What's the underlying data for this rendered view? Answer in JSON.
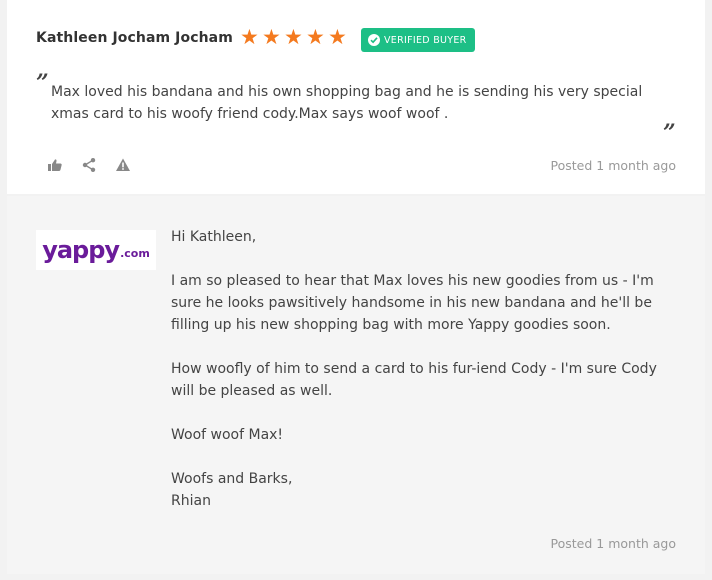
{
  "review": {
    "reviewer_name": "Kathleen Jocham Jocham",
    "rating": 5,
    "star_color": "#f47a1f",
    "verified_label": "VERIFIED BUYER",
    "verified_color": "#1dbf86",
    "open_quote": "”",
    "close_quote": "”",
    "text": "Max loved his bandana and his own shopping bag and he is sending his very special xmas card to his woofy friend cody.Max says woof woof .",
    "actions": [
      "thumbs-up-icon",
      "share-icon",
      "report-warning-icon"
    ],
    "posted": "Posted 1 month ago"
  },
  "reply": {
    "logo_text": "yappy",
    "logo_suffix": ".com",
    "logo_color": "#6a1b9a",
    "greeting": "Hi Kathleen,",
    "paragraph_1": "I am so pleased to hear that Max loves his new goodies from us - I'm sure he looks pawsitively handsome in his new bandana and he'll be filling up his new shopping bag with more Yappy goodies soon.",
    "paragraph_2": "How woofly of him to send a card to his fur-iend Cody - I'm sure Cody will be pleased as well.",
    "paragraph_3": "Woof woof Max!",
    "signoff_line_1": "Woofs and Barks,",
    "signoff_line_2": "Rhian",
    "posted": "Posted 1 month ago"
  }
}
